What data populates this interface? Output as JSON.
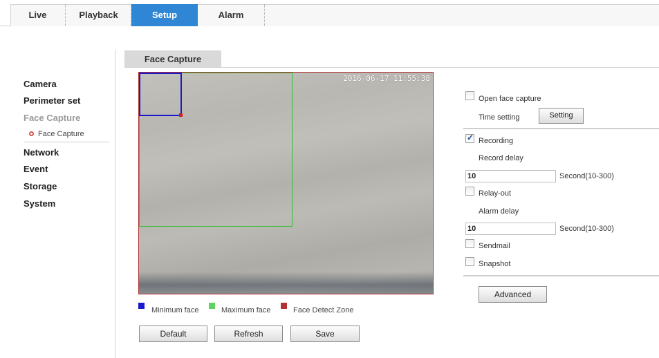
{
  "nav": {
    "tabs": [
      {
        "label": "Live"
      },
      {
        "label": "Playback"
      },
      {
        "label": "Setup"
      },
      {
        "label": "Alarm"
      }
    ],
    "active_tab": "Setup"
  },
  "sidebar": {
    "items": [
      {
        "label": "Camera"
      },
      {
        "label": "Perimeter set"
      },
      {
        "label": "Face Capture"
      },
      {
        "label": "Network"
      },
      {
        "label": "Event"
      },
      {
        "label": "Storage"
      },
      {
        "label": "System"
      }
    ],
    "sub_item": {
      "label": "Face Capture"
    }
  },
  "content": {
    "tab_label": "Face Capture",
    "video": {
      "timestamp": "2016-06-17 11:55:38"
    },
    "legend": [
      {
        "label": "Minimum face",
        "color": "#1a1acc"
      },
      {
        "label": "Maximum face",
        "color": "#2fbf2f"
      },
      {
        "label": "Face Detect Zone",
        "color": "#b23232"
      }
    ],
    "buttons": {
      "default": "Default",
      "refresh": "Refresh",
      "save": "Save"
    }
  },
  "settings": {
    "open_face_capture": {
      "label": "Open face capture",
      "checked": false
    },
    "time_setting_label": "Time setting",
    "setting_button": "Setting",
    "recording": {
      "label": "Recording",
      "checked": true
    },
    "record_delay_label": "Record delay",
    "record_delay_value": "10",
    "record_delay_unit": "Second(10-300)",
    "relay_out": {
      "label": "Relay-out",
      "checked": false
    },
    "alarm_delay_label": "Alarm delay",
    "alarm_delay_value": "10",
    "alarm_delay_unit": "Second(10-300)",
    "sendmail": {
      "label": "Sendmail",
      "checked": false
    },
    "snapshot": {
      "label": "Snapshot",
      "checked": false
    },
    "advanced_button": "Advanced"
  }
}
